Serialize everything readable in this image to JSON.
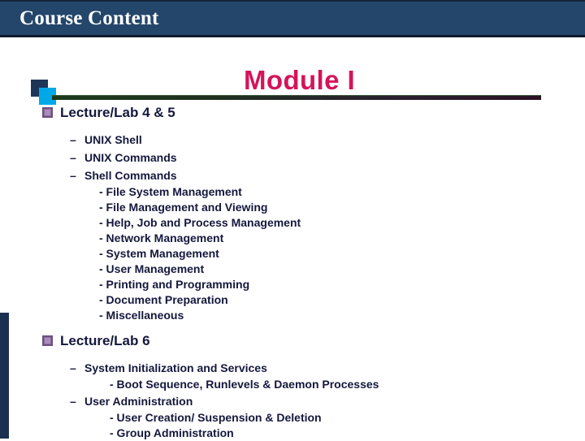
{
  "title_bar": {
    "text": "Course Content"
  },
  "slide": {
    "heading": "Module I",
    "decor": {
      "square_dark_color": "#1e3557",
      "square_cyan_color": "#00a8e8",
      "rule_left_color": "#1d3a1d",
      "rule_right_color": "#2b1224",
      "accent_strip_color": "#1b3050"
    },
    "colors": {
      "title_bar_bg": "#24466b",
      "title_bar_text": "#ffffff",
      "heading_text": "#d4145a",
      "body_text": "#14183c",
      "bullet_square": "#a98cba",
      "page_bg": "#ffffff"
    }
  },
  "sections": [
    {
      "label": "Lecture/Lab 4 & 5",
      "bullet_icon": "square-bullet-icon",
      "items": [
        {
          "label": "UNIX Shell",
          "sub": []
        },
        {
          "label": "UNIX Commands",
          "sub": []
        },
        {
          "label": "Shell Commands",
          "sub": [
            "- File System Management",
            "- File Management and Viewing",
            "- Help, Job and Process Management",
            "- Network Management",
            "- System Management",
            "- User Management",
            "- Printing and Programming",
            "- Document Preparation",
            "- Miscellaneous"
          ]
        }
      ]
    },
    {
      "label": "Lecture/Lab 6",
      "bullet_icon": "square-bullet-icon",
      "items": [
        {
          "label": "System Initialization and Services",
          "sub": [
            "- Boot Sequence, Runlevels & Daemon Processes"
          ]
        },
        {
          "label": "User Administration",
          "sub": [
            "- User Creation/ Suspension & Deletion",
            "- Group Administration"
          ]
        }
      ]
    }
  ]
}
